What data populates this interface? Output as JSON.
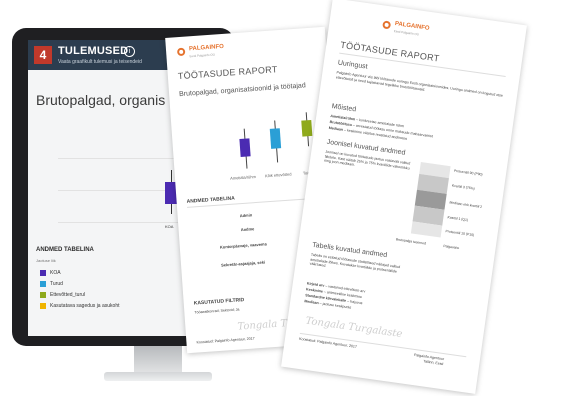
{
  "screen": {
    "step_number": "4",
    "title": "TULEMUSED",
    "info_glyph": "i",
    "subtitle": "Vaata graafikult tulemusi ja teisendeid",
    "chart_title": "Brutopalgad, organis",
    "x_label": "KOA",
    "table_title": "ANDMED TABELINA",
    "table_header": "Jaotuse liik",
    "legend": [
      {
        "label": "KOA",
        "color": "#4b2bb2"
      },
      {
        "label": "Turud",
        "color": "#2a9fd6"
      },
      {
        "label": "Ettevõtted_turul",
        "color": "#8faa1c"
      },
      {
        "label": "Kasutatava sagedus ja asukoht",
        "color": "#f0b400"
      }
    ]
  },
  "report_front": {
    "brand": "PALGAINFO",
    "brand_sub": "Eesti Palgainfo OÜ",
    "title": "TÖÖTASUDE RAPORT",
    "subtitle": "Brutopalgad, organisatsioonid ja töötajad",
    "x_labels": [
      "Ametiala/rühm",
      "Kõik ettevõtted",
      "Toimik"
    ],
    "table_title": "ANDMED TABELINA",
    "rows": [
      "Admin",
      "Andme",
      "Kontorpäevaje, vaavema",
      "Sekretär-asjaajaja, seki"
    ],
    "section2": "KASUTATUD FILTRID",
    "section2_text": "Tööaeatkonrad; Sektorid; Ja",
    "footer": "Koostatud: Palgainfo Agentuur, 2017",
    "signature": "Tongala Turgalaste"
  },
  "report_back": {
    "brand": "PALGAINFO",
    "brand_sub": "Eesti Palgainfo OÜ",
    "title": "TÖÖTASUDE RAPORT",
    "h1": "Uuringust",
    "p1": "Palgainfo Agentuur viis läbi töötasude uuringu Eesti organisatsioonides. Uuringu andmed on kogutud otse ettevõtetelt ja need kajastavad tegelikke brutotöötasusid.",
    "h2": "Mõisted",
    "terms": [
      {
        "term": "Ametiala/rühm",
        "desc": "konkreetse ametialade rühm"
      },
      {
        "term": "Brutotöötasu",
        "desc": "arvestatud töötasu enne maksude mahaarvamist"
      },
      {
        "term": "Mediaan",
        "desc": "keskmine väärtus reastatud andmetes"
      }
    ],
    "h3": "Joonisel kuvatud andmed",
    "p3": "Joonisel on kuvatud töötasude jaotus vastavalt valitud filtritele. Kast näitab 25% ja 75% kvartiilide vahemikku ning joon mediaani.",
    "stack_labels": [
      "Protsentiil 90 (P90)",
      "Kvartiil 3 (75%)",
      "Mediaan ehk kvartiil 2",
      "Kvartiil 1 (Q1)",
      "Protsentiil 10 (P10)"
    ],
    "stack_bottom_left": "Brutopalga tasemed",
    "stack_bottom_right": "Palgavahe",
    "h4": "Tabelis kuvatud andmed",
    "p4": "Tabelis on esitatud töötasude statistilised näitajad valitud ametialade lõikes. Kuvatakse kvartiilide ja protsentiilide väärtused.",
    "terms2": [
      {
        "term": "Kirjeid arv",
        "desc": "vastanud ettevõtete arv"
      },
      {
        "term": "Keskmine",
        "desc": "aritmeetiline keskmine"
      },
      {
        "term": "Standardne kõrvalekalle",
        "desc": "hajuvus"
      },
      {
        "term": "Mediaan",
        "desc": "jaotuse keskpunkt"
      }
    ],
    "footer": "Koostatud: Palgainfo Agentuur, 2017",
    "contact": "Palgainfo Agentuur\nTallinn, Eesti",
    "signature": "Tongala Turgalaste"
  }
}
